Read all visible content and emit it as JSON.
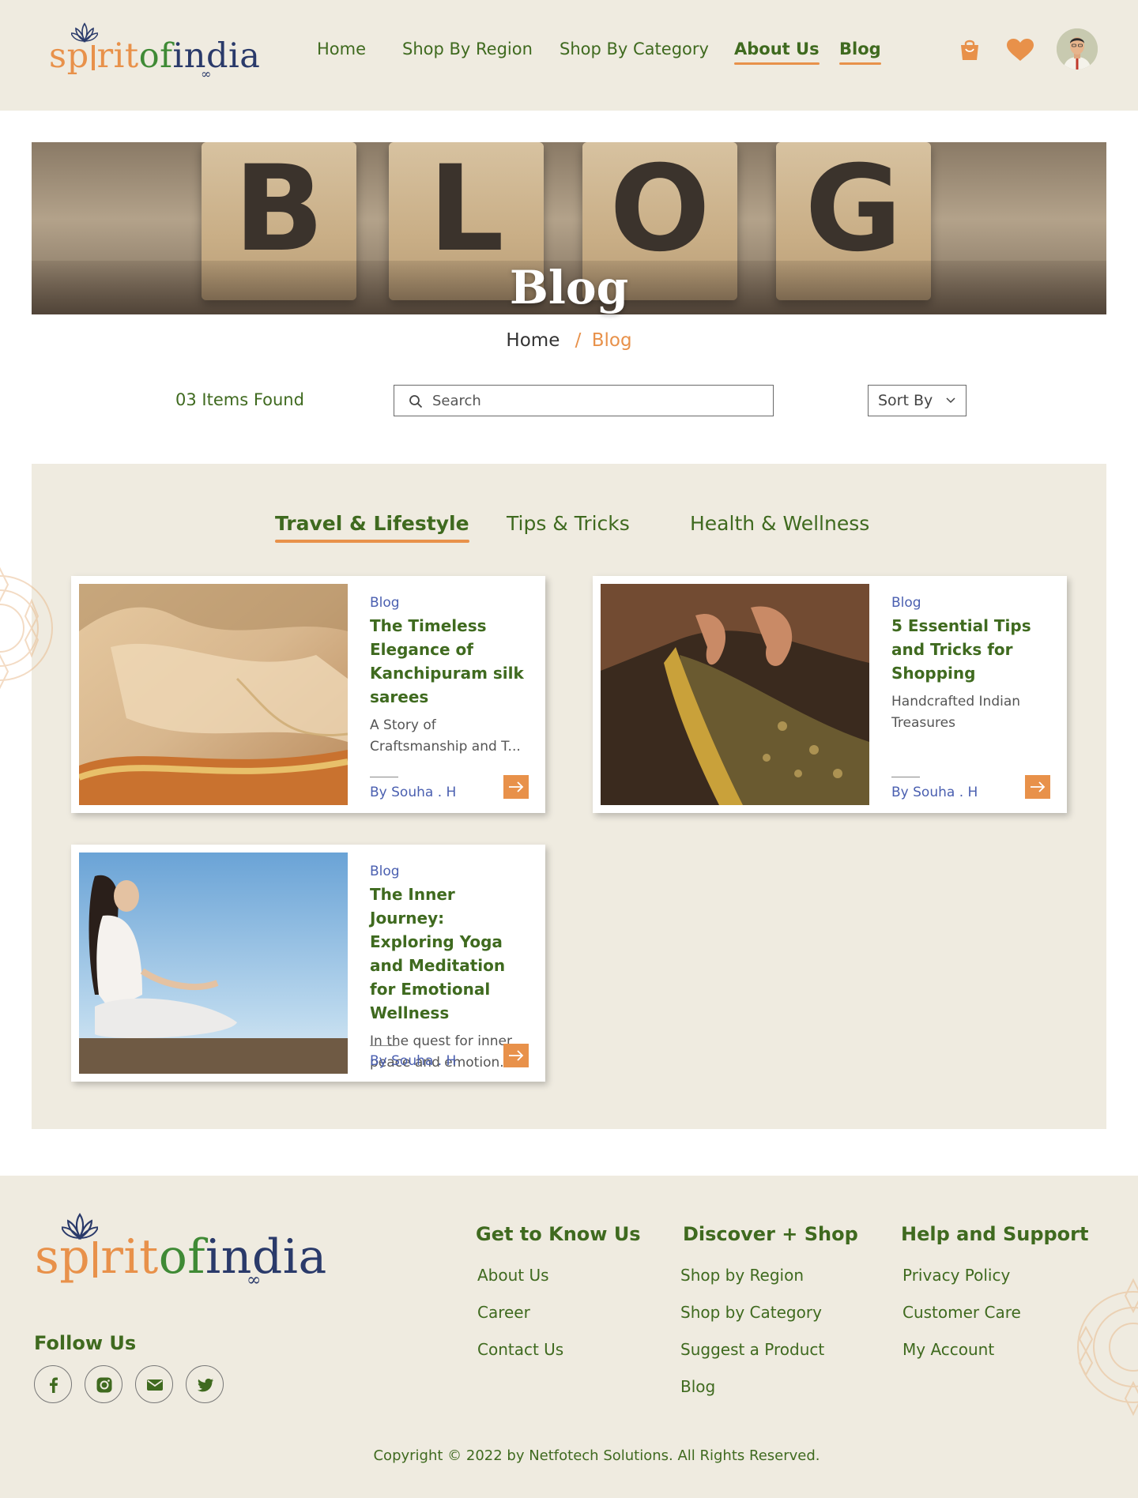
{
  "brand": {
    "logo_parts": [
      "sp",
      "ritofindia"
    ],
    "logo_orange": "sp",
    "logo_orange2": "rit",
    "logo_green": "of",
    "logo_navy": "india",
    "colors": {
      "orange": "#e8914a",
      "green": "#3f6a1f",
      "navy": "#2a3a6a",
      "blue": "#4a5fb0",
      "beige": "#efebe0"
    }
  },
  "header": {
    "nav": [
      {
        "label": "Home",
        "active": false
      },
      {
        "label": "Shop By Region",
        "active": false
      },
      {
        "label": "Shop By Category",
        "active": false
      },
      {
        "label": "About Us",
        "active": true
      },
      {
        "label": "Blog",
        "active": true
      }
    ],
    "icons": [
      "shopping-bag-icon",
      "heart-icon",
      "user-avatar"
    ]
  },
  "hero": {
    "letters": [
      "B",
      "L",
      "O",
      "G"
    ],
    "title": "Blog"
  },
  "breadcrumb": {
    "home": "Home",
    "separator": "/",
    "current": "Blog"
  },
  "toolbar": {
    "items_found": "03 Items Found",
    "search_placeholder": "Search",
    "sort_label": "Sort By"
  },
  "tabs": [
    {
      "label": "Travel & Lifestyle",
      "active": true
    },
    {
      "label": "Tips & Tricks",
      "active": false
    },
    {
      "label": "Health & Wellness",
      "active": false
    }
  ],
  "posts": [
    {
      "kicker": "Blog",
      "title": "The Timeless Elegance of Kanchipuram silk sarees",
      "excerpt": "A Story of Craftsmanship and T...",
      "author": "By Souha . H",
      "image": "silk-saree-photo"
    },
    {
      "kicker": "Blog",
      "title": "5 Essential Tips and Tricks for Shopping",
      "excerpt": "Handcrafted Indian Treasures",
      "author": "By Souha . H",
      "image": "embroidered-fabric-photo"
    },
    {
      "kicker": "Blog",
      "title": "The Inner Journey: Exploring Yoga and Meditation for Emotional Wellness",
      "excerpt": "In the quest for inner peace and emotion...",
      "author": "By Souha . H",
      "image": "yoga-meditation-photo"
    }
  ],
  "footer": {
    "follow_label": "Follow Us",
    "social": [
      "facebook-icon",
      "instagram-icon",
      "mail-icon",
      "twitter-icon"
    ],
    "columns": [
      {
        "heading": "Get to Know Us",
        "links": [
          "About Us",
          "Career",
          "Contact Us"
        ]
      },
      {
        "heading": "Discover + Shop",
        "links": [
          "Shop by Region",
          "Shop by Category",
          "Suggest a Product",
          "Blog"
        ]
      },
      {
        "heading": "Help and Support",
        "links": [
          "Privacy Policy",
          "Customer Care",
          "My Account"
        ]
      }
    ],
    "copyright": "Copyright © 2022 by Netfotech Solutions. All Rights Reserved."
  }
}
